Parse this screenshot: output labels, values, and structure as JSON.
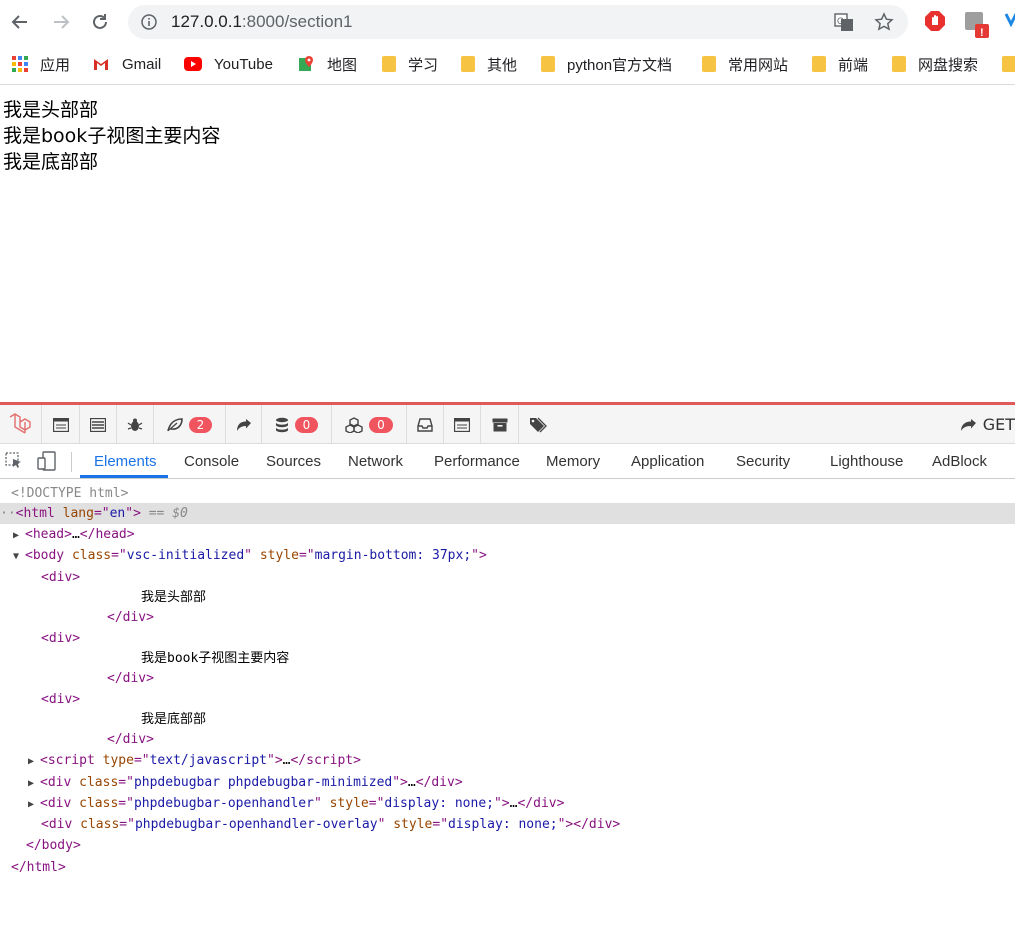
{
  "browser": {
    "url_host": "127.0.0.1",
    "url_rest": ":8000/section1",
    "bookmarks": [
      "应用",
      "Gmail",
      "YouTube",
      "地图",
      "学习",
      "其他",
      "python官方文档",
      "常用网站",
      "前端",
      "网盘搜索"
    ]
  },
  "page": {
    "lines": [
      "我是头部部",
      "我是book子视图主要内容",
      "我是底部部"
    ]
  },
  "debugbar": {
    "badge_1": "2",
    "badge_2": "0",
    "badge_3": "0",
    "get_label": "GET"
  },
  "devtools": {
    "tabs": [
      "Elements",
      "Console",
      "Sources",
      "Network",
      "Performance",
      "Memory",
      "Application",
      "Security",
      "Lighthouse",
      "AdBlock"
    ],
    "active_tab": "Elements",
    "doctype": "<!DOCTYPE html>",
    "html_lang": "en",
    "selected_marker": "== $0",
    "body_class": "vsc-initialized",
    "body_style": "margin-bottom: 37px;",
    "div_texts": [
      "我是头部部",
      "我是book子视图主要内容",
      "我是底部部"
    ],
    "script_type": "text/javascript",
    "div_class_1": "phpdebugbar phpdebugbar-minimized",
    "div_class_2": "phpdebugbar-openhandler",
    "div_style_2": "display: none;",
    "div_class_3": "phpdebugbar-openhandler-overlay",
    "div_style_3": "display: none;"
  }
}
